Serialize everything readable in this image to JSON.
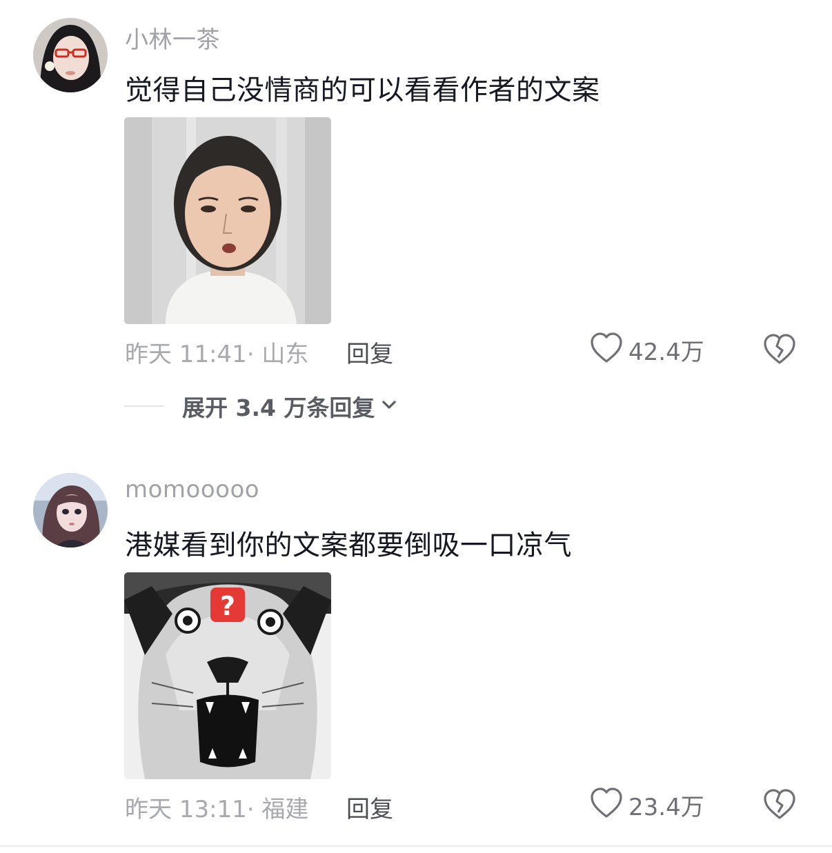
{
  "comments": [
    {
      "username": "小林一茶",
      "text": "觉得自己没情商的可以看看作者的文案",
      "meta": "昨天 11:41· 山东",
      "reply_label": "回复",
      "likes": "42.4万",
      "expand_label": "展开 3.4 万条回复"
    },
    {
      "username": "momooooo",
      "text": "港媒看到你的文案都要倒吸一口凉气",
      "meta": "昨天 13:11· 福建",
      "reply_label": "回复",
      "likes": "23.4万"
    }
  ],
  "sticker_badge": "?",
  "icons": {
    "like": "heart-outline-icon",
    "dislike": "broken-heart-icon",
    "expand": "chevron-down-icon"
  },
  "colors": {
    "text_primary": "#161823",
    "text_secondary": "#a1a2a7",
    "badge_red": "#e53935"
  }
}
